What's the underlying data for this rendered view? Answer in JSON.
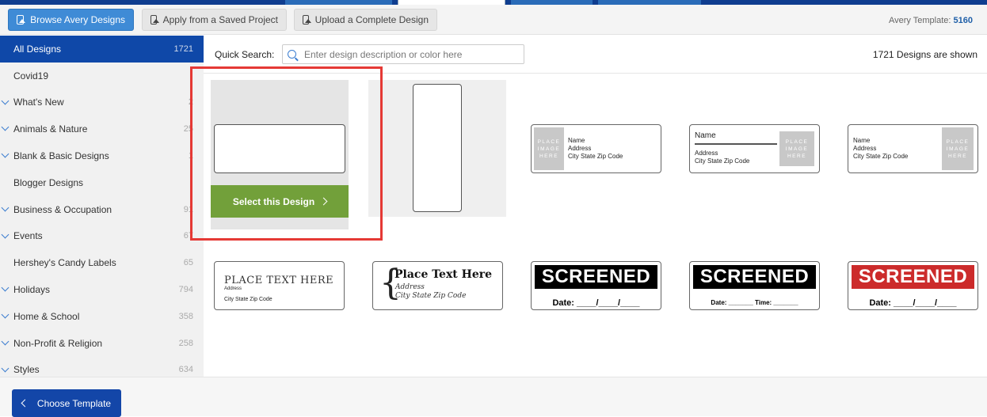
{
  "toolbar": {
    "browse_label": "Browse Avery Designs",
    "apply_label": "Apply from a Saved Project",
    "upload_label": "Upload a Complete Design",
    "template_prefix": "Avery Template: ",
    "template_number": "5160"
  },
  "sidebar": {
    "items": [
      {
        "label": "All Designs",
        "count": "1721",
        "active": true,
        "expandable": false
      },
      {
        "label": "Covid19",
        "count": "",
        "active": false,
        "expandable": false
      },
      {
        "label": "What's New",
        "count": "2",
        "active": false,
        "expandable": true
      },
      {
        "label": "Animals & Nature",
        "count": "25",
        "active": false,
        "expandable": true
      },
      {
        "label": "Blank & Basic Designs",
        "count": "1",
        "active": false,
        "expandable": true
      },
      {
        "label": "Blogger Designs",
        "count": "",
        "active": false,
        "expandable": false
      },
      {
        "label": "Business & Occupation",
        "count": "91",
        "active": false,
        "expandable": true
      },
      {
        "label": "Events",
        "count": "67",
        "active": false,
        "expandable": true
      },
      {
        "label": "Hershey's Candy Labels",
        "count": "65",
        "active": false,
        "expandable": false
      },
      {
        "label": "Holidays",
        "count": "794",
        "active": false,
        "expandable": true
      },
      {
        "label": "Home & School",
        "count": "358",
        "active": false,
        "expandable": true
      },
      {
        "label": "Non-Profit & Religion",
        "count": "258",
        "active": false,
        "expandable": true
      },
      {
        "label": "Styles",
        "count": "634",
        "active": false,
        "expandable": true
      }
    ]
  },
  "search": {
    "label": "Quick Search:",
    "placeholder": "Enter design description or color here",
    "value": ""
  },
  "results": {
    "shown_text": "1721 Designs are shown"
  },
  "designs": {
    "select_label": "Select this Design",
    "placeholder_image": [
      "PLACE",
      "IMAGE",
      "HERE"
    ],
    "name": "Name",
    "address": "Address",
    "city": "City State Zip Code",
    "place_text_caps": "PLACE TEXT HERE",
    "place_text": "Place Text Here",
    "screened": "SCREENED",
    "date_line": "Date: ____/____/____",
    "date_time_line": "Date: _______ Time: _______",
    "screened_colors": {
      "dark": "#000000",
      "red": "#cc2b2b"
    }
  },
  "footer": {
    "choose_label": "Choose Template"
  },
  "colors": {
    "nav_blue": "#0f48a8",
    "primary_button": "#3f8bd6",
    "select_green": "#72a03a",
    "highlight_red": "#e53935"
  }
}
